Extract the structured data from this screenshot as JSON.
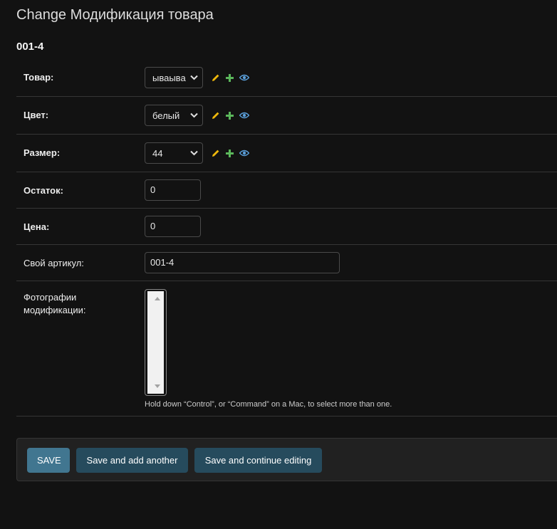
{
  "page": {
    "title": "Change Модификация товара",
    "object_title": "001-4"
  },
  "fields": {
    "product": {
      "label": "Товар:",
      "value": "ываыва"
    },
    "color": {
      "label": "Цвет:",
      "value": "белый"
    },
    "size": {
      "label": "Размер:",
      "value": "44"
    },
    "stock": {
      "label": "Остаток:",
      "value": "0"
    },
    "price": {
      "label": "Цена:",
      "value": "0"
    },
    "article": {
      "label": "Свой артикул:",
      "value": "001-4"
    },
    "photos": {
      "label": "Фотографии модификации:",
      "help": "Hold down “Control”, or “Command” on a Mac, to select more than one."
    }
  },
  "icons": {
    "edit": {
      "name": "pencil-icon",
      "color": "#efb80b"
    },
    "add": {
      "name": "plus-icon",
      "color": "#5bb75b"
    },
    "view": {
      "name": "eye-icon",
      "color": "#5a9ed8"
    }
  },
  "buttons": {
    "save": "SAVE",
    "save_add_another": "Save and add another",
    "save_continue": "Save and continue editing"
  },
  "colors": {
    "background": "#121212",
    "primary_button": "#417690",
    "secondary_button": "#264b5d"
  }
}
